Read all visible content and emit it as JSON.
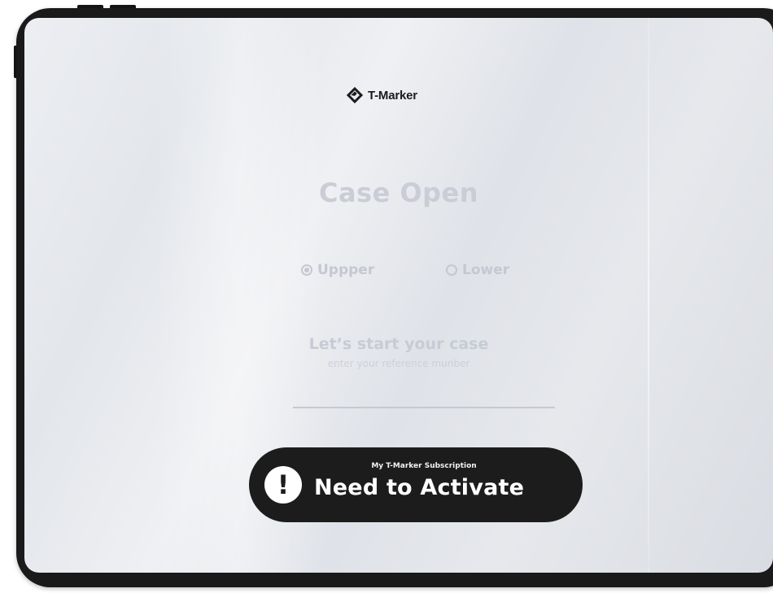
{
  "app": {
    "name": "T-Marker"
  },
  "page": {
    "title": "Case Open"
  },
  "case_position": {
    "options": [
      {
        "label": "Uppper",
        "selected": true
      },
      {
        "label": "Lower",
        "selected": false
      }
    ]
  },
  "reference": {
    "heading": "Let’s start your case",
    "hint": "enter your reference munber",
    "value": ""
  },
  "subscription": {
    "caption": "My T-Marker Subscription",
    "status": "Need to Activate",
    "icon": "exclamation-icon"
  },
  "colors": {
    "frame": "#1a1a1a",
    "muted_text": "#c7cbd4",
    "button_bg": "#1c1c1c"
  }
}
